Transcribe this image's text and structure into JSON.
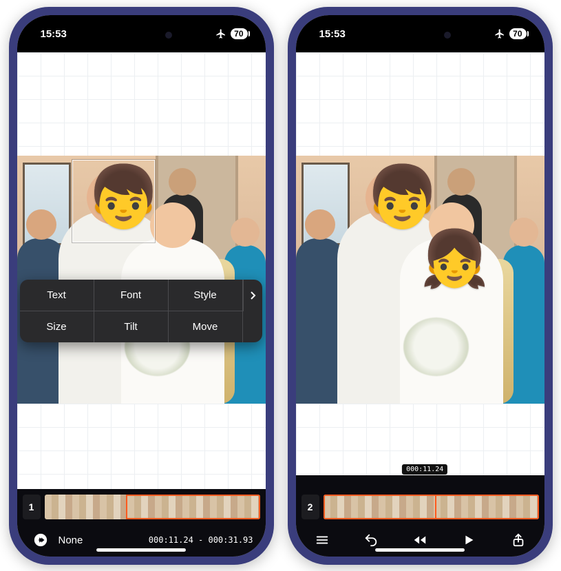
{
  "status": {
    "time": "15:53",
    "battery": "70"
  },
  "emoji": {
    "boy": "👦",
    "girl": "👧"
  },
  "popover": {
    "text": "Text",
    "font": "Font",
    "style": "Style",
    "size": "Size",
    "tilt": "Tilt",
    "move": "Move"
  },
  "left": {
    "clip_index": "1",
    "effect_label": "None",
    "range": "000:11.24 - 000:31.93"
  },
  "right": {
    "clip_index": "2",
    "playhead": "000:11.24"
  }
}
